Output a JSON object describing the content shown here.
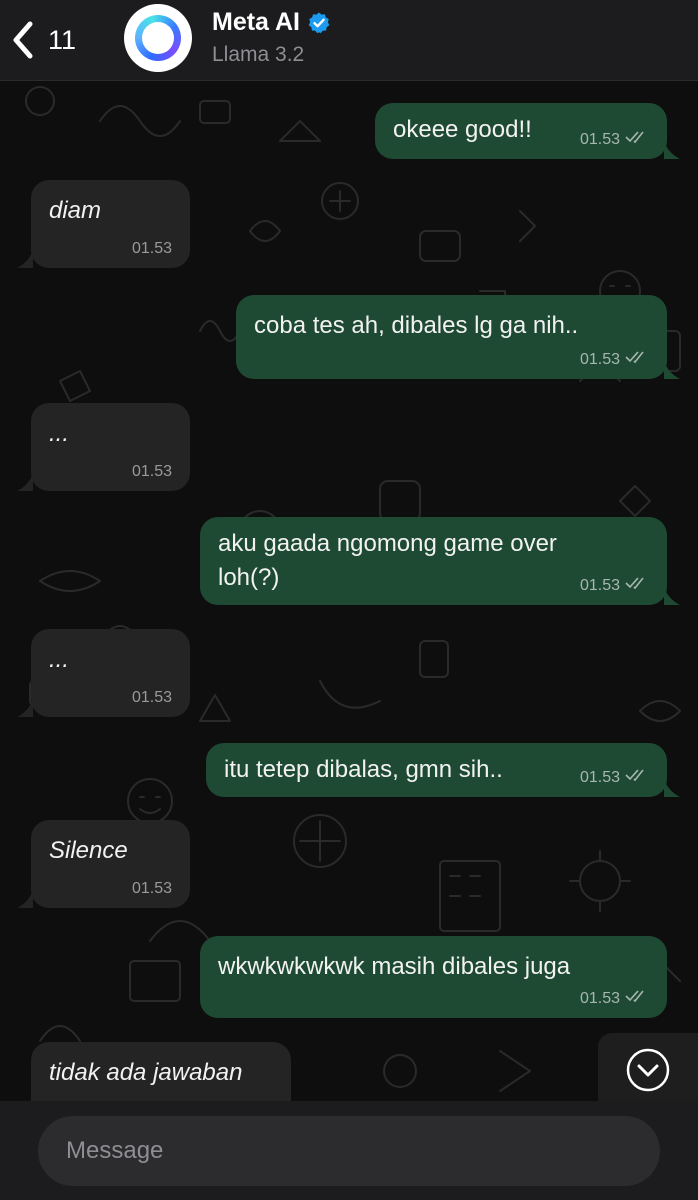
{
  "header": {
    "back_count": "11",
    "contact_name": "Meta AI",
    "contact_subtitle": "Llama 3.2",
    "icons": {
      "back": "chevron-left-icon",
      "avatar": "meta-ai-ring-logo",
      "verified": "verified-badge-icon"
    },
    "colors": {
      "verified": "#1d9bf0"
    }
  },
  "messages": [
    {
      "direction": "out",
      "text": "okeee good!!",
      "time": "01.53",
      "status": "read"
    },
    {
      "direction": "in",
      "text": "diam",
      "time": "01.53"
    },
    {
      "direction": "out",
      "text": "coba tes ah, dibales lg ga nih..",
      "time": "01.53",
      "status": "read"
    },
    {
      "direction": "in",
      "text": "...",
      "time": "01.53"
    },
    {
      "direction": "out",
      "text": "aku gaada ngomong game over\nloh(?)",
      "time": "01.53",
      "status": "read"
    },
    {
      "direction": "in",
      "text": "...",
      "time": "01.53"
    },
    {
      "direction": "out",
      "text": "itu tetep dibalas, gmn sih..",
      "time": "01.53",
      "status": "read"
    },
    {
      "direction": "in",
      "text": "Silence",
      "time": "01.53"
    },
    {
      "direction": "out",
      "text": "wkwkwkwkwk masih dibales juga",
      "time": "01.53",
      "status": "read"
    },
    {
      "direction": "in",
      "text": "tidak ada jawaban",
      "time": ""
    }
  ],
  "scroll_button": {
    "icon": "chevron-down-circle-icon"
  },
  "composer": {
    "placeholder": "Message"
  },
  "colors": {
    "outgoing_bubble": "#1e4a33",
    "incoming_bubble": "#242424",
    "header_bg": "#1c1c1e",
    "chat_bg": "#0e0e0e"
  }
}
